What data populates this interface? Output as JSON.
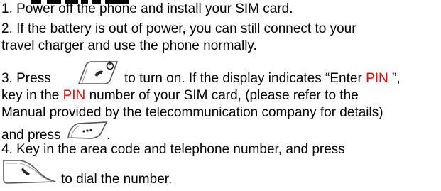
{
  "colors": {
    "text": "#000000",
    "highlight": "#ff0000",
    "key_outline": "#555555"
  },
  "icons": {
    "power_key": "power-key-icon",
    "menu_key": "menu-key-icon",
    "send_key": "send-key-icon"
  },
  "steps": {
    "s1": "1. Power off the phone and install your SIM card.",
    "s2_line1": "2. If the battery is out of power, you can still connect to your",
    "s2_line2": "travel charger and use the phone normally.",
    "s3_press": "3. Press",
    "s3_turn_on": "to turn on. If the display indicates “Enter",
    "s3_pin1": "PIN",
    "s3_quote_close": " ”,",
    "s3_keyin": "key in the",
    "s3_pin2": "PIN",
    "s3_number_rest": "number of your SIM card, (please refer to the",
    "s3_manual": "Manual provided by the telecommunication company for details)",
    "s3_and_press": "and press",
    "s3_period": ".",
    "s4_line1": "4. Key in the area code and telephone number, and press",
    "s4_dial": "to dial the number."
  }
}
